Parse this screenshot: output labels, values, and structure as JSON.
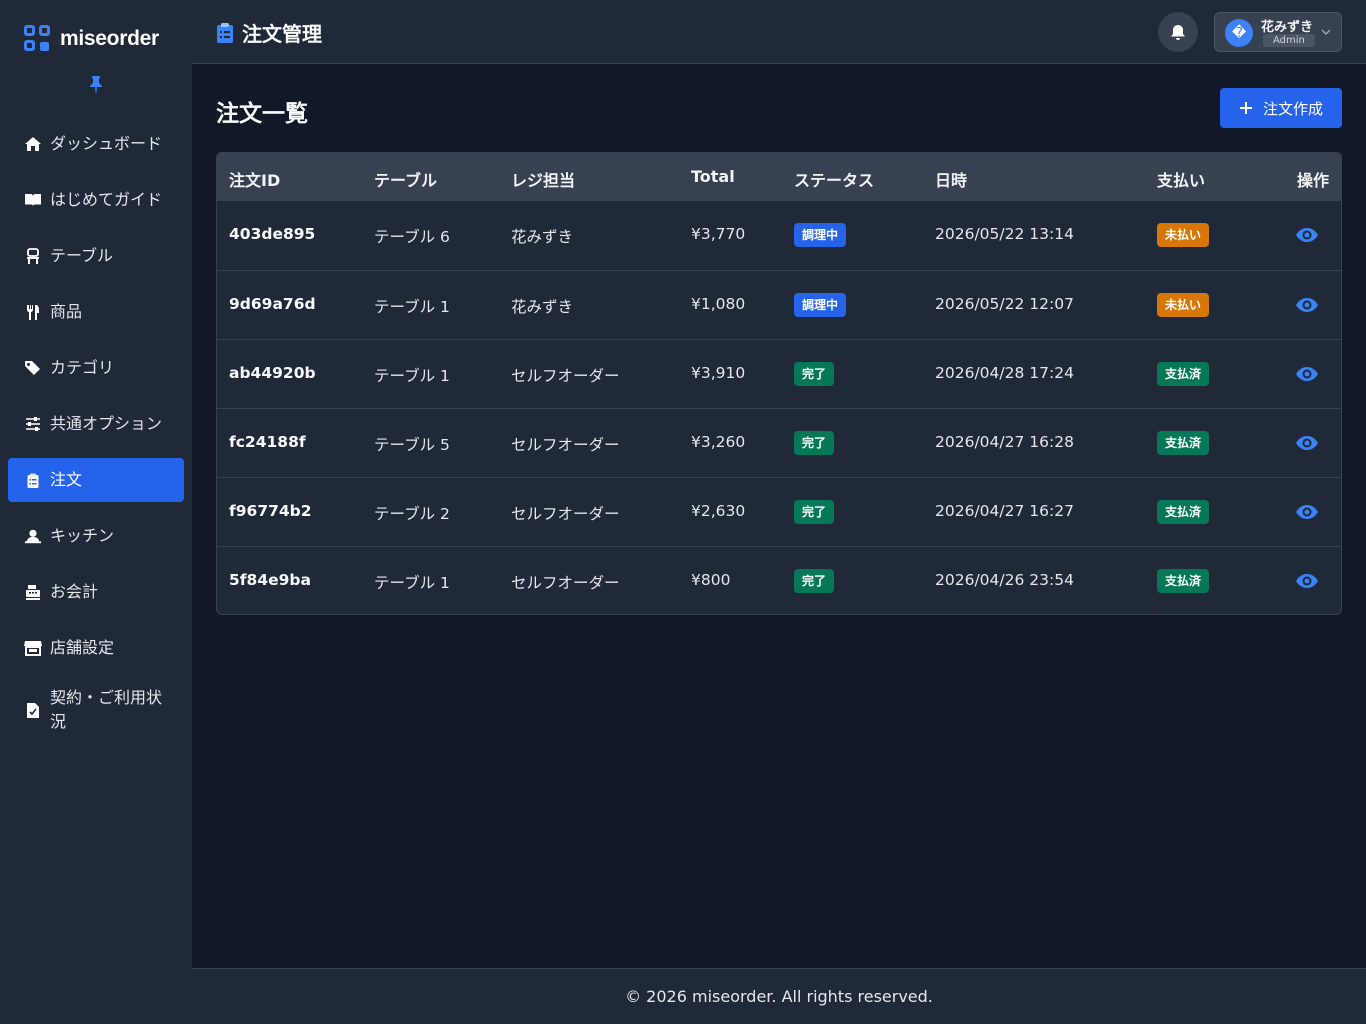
{
  "brand": {
    "logo_text": "miseorder",
    "accent": "#3b82f6"
  },
  "sidebar": {
    "items": [
      {
        "label": "ダッシュボード",
        "icon": "home-icon",
        "active": false
      },
      {
        "label": "はじめてガイド",
        "icon": "book-icon",
        "active": false
      },
      {
        "label": "テーブル",
        "icon": "chair-icon",
        "active": false
      },
      {
        "label": "商品",
        "icon": "utensils-icon",
        "active": false
      },
      {
        "label": "カテゴリ",
        "icon": "tags-icon",
        "active": false
      },
      {
        "label": "共通オプション",
        "icon": "sliders-icon",
        "active": false
      },
      {
        "label": "注文",
        "icon": "clipboard-icon",
        "active": true
      },
      {
        "label": "キッチン",
        "icon": "chef-icon",
        "active": false
      },
      {
        "label": "お会計",
        "icon": "cash-register-icon",
        "active": false
      },
      {
        "label": "店舗設定",
        "icon": "store-icon",
        "active": false
      },
      {
        "label": "契約・ご利用状況",
        "icon": "contract-icon",
        "active": false
      }
    ]
  },
  "header": {
    "title": "注文管理",
    "user": {
      "avatar_glyph": "�",
      "name": "花みずき",
      "role": "Admin"
    }
  },
  "main": {
    "page_title": "注文一覧",
    "create_button": "注文作成",
    "table": {
      "columns": [
        "注文ID",
        "テーブル",
        "レジ担当",
        "Total",
        "ステータス",
        "日時",
        "支払い",
        "操作"
      ],
      "rows": [
        {
          "id": "403de895",
          "table": "テーブル 6",
          "cashier": "花みずき",
          "total": "¥3,770",
          "status": "調理中",
          "status_color": "#2563eb",
          "datetime": "2026/05/22 13:14",
          "payment": "未払い",
          "payment_color": "#d97706"
        },
        {
          "id": "9d69a76d",
          "table": "テーブル 1",
          "cashier": "花みずき",
          "total": "¥1,080",
          "status": "調理中",
          "status_color": "#2563eb",
          "datetime": "2026/05/22 12:07",
          "payment": "未払い",
          "payment_color": "#d97706"
        },
        {
          "id": "ab44920b",
          "table": "テーブル 1",
          "cashier": "セルフオーダー",
          "total": "¥3,910",
          "status": "完了",
          "status_color": "#047857",
          "datetime": "2026/04/28 17:24",
          "payment": "支払済",
          "payment_color": "#047857"
        },
        {
          "id": "fc24188f",
          "table": "テーブル 5",
          "cashier": "セルフオーダー",
          "total": "¥3,260",
          "status": "完了",
          "status_color": "#047857",
          "datetime": "2026/04/27 16:28",
          "payment": "支払済",
          "payment_color": "#047857"
        },
        {
          "id": "f96774b2",
          "table": "テーブル 2",
          "cashier": "セルフオーダー",
          "total": "¥2,630",
          "status": "完了",
          "status_color": "#047857",
          "datetime": "2026/04/27 16:27",
          "payment": "支払済",
          "payment_color": "#047857"
        },
        {
          "id": "5f84e9ba",
          "table": "テーブル 1",
          "cashier": "セルフオーダー",
          "total": "¥800",
          "status": "完了",
          "status_color": "#047857",
          "datetime": "2026/04/26 23:54",
          "payment": "支払済",
          "payment_color": "#047857"
        }
      ]
    }
  },
  "footer": {
    "text": "© 2026 miseorder. All rights reserved."
  }
}
